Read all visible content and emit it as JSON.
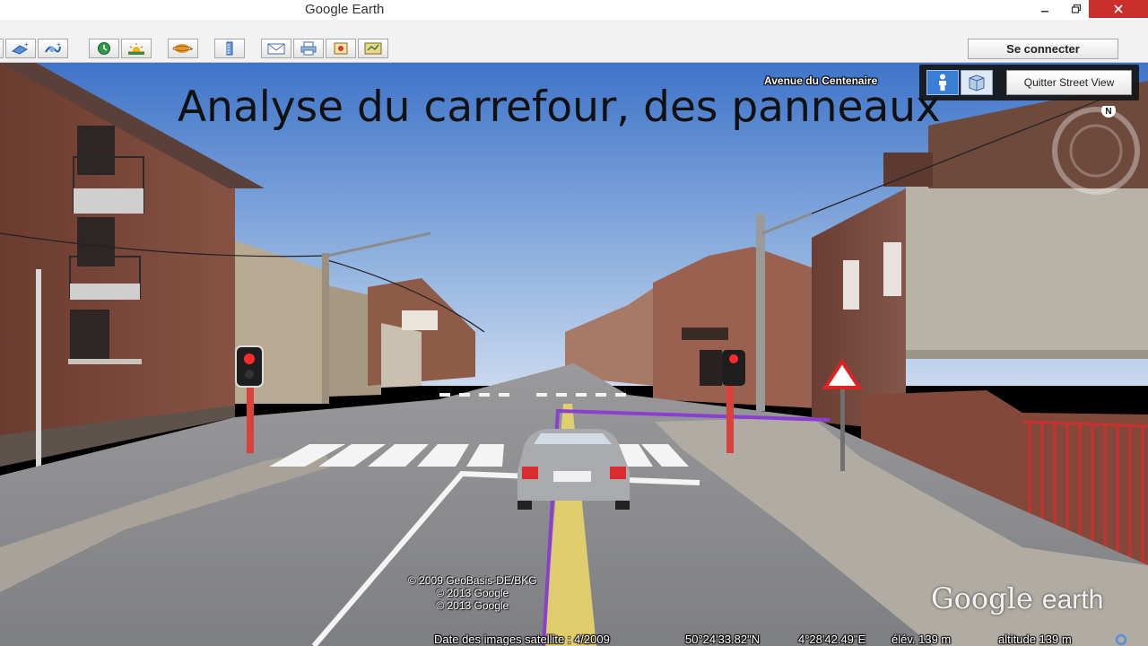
{
  "window": {
    "title": "Google Earth",
    "controls": {
      "minimize": "–",
      "maximize": "❐",
      "close": "✕"
    }
  },
  "toolbar": {
    "buttons": [
      {
        "name": "add-placemark-button",
        "icon": "placemark-plus-icon"
      },
      {
        "name": "add-polygon-button",
        "icon": "polygon-plus-icon"
      },
      {
        "name": "add-path-button",
        "icon": "path-plus-icon"
      },
      {
        "name": "historical-imagery-button",
        "icon": "clock-icon"
      },
      {
        "name": "sunlight-button",
        "icon": "sun-icon"
      },
      {
        "name": "switch-planet-button",
        "icon": "planet-icon"
      },
      {
        "name": "ruler-button",
        "icon": "ruler-icon"
      },
      {
        "name": "email-button",
        "icon": "envelope-icon"
      },
      {
        "name": "print-button",
        "icon": "printer-icon"
      },
      {
        "name": "save-image-button",
        "icon": "save-image-icon"
      },
      {
        "name": "view-in-maps-button",
        "icon": "map-icon"
      }
    ],
    "signin_label": "Se connecter"
  },
  "viewport": {
    "slide_title": "Analyse  du carrefour, des panneaux",
    "street_name": "Avenue du Centenaire",
    "quit_street_view_label": "Quitter Street View",
    "compass_letter": "N",
    "copyright": [
      "© 2009 GeoBasis-DE/BKG",
      "© 2013 Google",
      "© 2013 Google"
    ],
    "brand": {
      "google": "Google",
      "earth": "earth"
    },
    "status": {
      "imagery_date": "Date des images satellite : 4/2009",
      "latitude": "50°24'33.82\"N",
      "longitude": "4°28'42.49\"E",
      "elevation": "élév.  139 m",
      "altitude": "altitude   139 m"
    }
  },
  "colors": {
    "close_button": "#c9302c",
    "sky_top": "#3f74c9",
    "road": "#8d8d8f",
    "brick": "#7a4a3c",
    "guide_line": "#8a3fd0",
    "yellow_lane": "#e6d36b"
  }
}
